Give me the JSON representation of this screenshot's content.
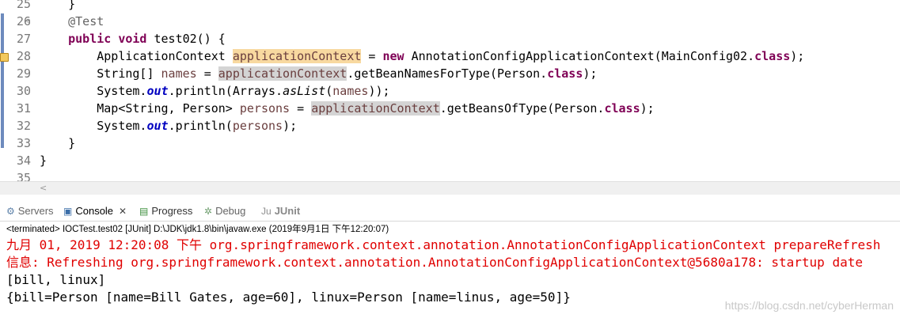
{
  "editor": {
    "lines": [
      {
        "no": "25",
        "fold": "",
        "code": [
          {
            "t": "    }"
          }
        ]
      },
      {
        "no": "26",
        "fold": "⊖",
        "code": [
          {
            "t": "    "
          },
          {
            "t": "@Test",
            "c": "ann"
          }
        ]
      },
      {
        "no": "27",
        "fold": "",
        "code": [
          {
            "t": "    "
          },
          {
            "t": "public",
            "c": "kw"
          },
          {
            "t": " "
          },
          {
            "t": "void",
            "c": "kw"
          },
          {
            "t": " test02() {"
          }
        ]
      },
      {
        "no": "28",
        "fold": "",
        "warn": true,
        "code": [
          {
            "t": "        ApplicationContext "
          },
          {
            "t": "applicationContext",
            "c": "var occ-w"
          },
          {
            "t": " = "
          },
          {
            "t": "new",
            "c": "kw"
          },
          {
            "t": " AnnotationConfigApplicationContext(MainConfig02."
          },
          {
            "t": "class",
            "c": "kw"
          },
          {
            "t": ");"
          }
        ]
      },
      {
        "no": "29",
        "fold": "",
        "code": [
          {
            "t": "        String[] "
          },
          {
            "t": "names",
            "c": "var"
          },
          {
            "t": " = "
          },
          {
            "t": "applicationContext",
            "c": "var occ-r"
          },
          {
            "t": ".getBeanNamesForType(Person."
          },
          {
            "t": "class",
            "c": "kw"
          },
          {
            "t": ");"
          }
        ]
      },
      {
        "no": "30",
        "fold": "",
        "code": [
          {
            "t": "        System."
          },
          {
            "t": "out",
            "c": "fld"
          },
          {
            "t": ".println(Arrays."
          },
          {
            "t": "asList",
            "c": "it"
          },
          {
            "t": "("
          },
          {
            "t": "names",
            "c": "var"
          },
          {
            "t": "));"
          }
        ]
      },
      {
        "no": "31",
        "fold": "",
        "code": [
          {
            "t": "        Map<String, Person> "
          },
          {
            "t": "persons",
            "c": "var"
          },
          {
            "t": " = "
          },
          {
            "t": "applicationContext",
            "c": "var occ-r"
          },
          {
            "t": ".getBeansOfType(Person."
          },
          {
            "t": "class",
            "c": "kw"
          },
          {
            "t": ");"
          }
        ]
      },
      {
        "no": "32",
        "fold": "",
        "code": [
          {
            "t": "        System."
          },
          {
            "t": "out",
            "c": "fld"
          },
          {
            "t": ".println("
          },
          {
            "t": "persons",
            "c": "var"
          },
          {
            "t": ");"
          }
        ]
      },
      {
        "no": "33",
        "fold": "",
        "code": [
          {
            "t": "    }"
          }
        ]
      },
      {
        "no": "34",
        "fold": "",
        "code": [
          {
            "t": "}"
          }
        ]
      },
      {
        "no": "35",
        "fold": "",
        "code": [
          {
            "t": ""
          }
        ]
      }
    ]
  },
  "views": {
    "tabs": [
      {
        "label": "Servers",
        "icon": "servers-icon",
        "glyph": "⚙",
        "color": "#5a7fa8",
        "active": false
      },
      {
        "label": "Console",
        "icon": "console-icon",
        "glyph": "▣",
        "color": "#3b6ea8",
        "active": true,
        "close": "✕"
      },
      {
        "label": "Progress",
        "icon": "progress-icon",
        "glyph": "▤",
        "color": "#3c8f3c",
        "active": false
      },
      {
        "label": "Debug",
        "icon": "debug-icon",
        "glyph": "✲",
        "color": "#6e9e6e",
        "active": false
      },
      {
        "label": "JUnit",
        "icon": "junit-icon",
        "glyph": "Ju",
        "color": "#8e8e8e",
        "active": false
      }
    ]
  },
  "console": {
    "status": "<terminated> IOCTest.test02 [JUnit] D:\\JDK\\jdk1.8\\bin\\javaw.exe (2019年9月1日 下午12:20:07)",
    "lines": [
      {
        "text": "九月 01, 2019 12:20:08 下午 org.springframework.context.annotation.AnnotationConfigApplicationContext prepareRefresh",
        "type": "err"
      },
      {
        "text": "信息: Refreshing org.springframework.context.annotation.AnnotationConfigApplicationContext@5680a178: startup date",
        "type": "err"
      },
      {
        "text": "[bill, linux]",
        "type": "out"
      },
      {
        "text": "{bill=Person [name=Bill Gates, age=60], linux=Person [name=linus, age=50]}",
        "type": "out"
      }
    ],
    "watermark": "https://blog.csdn.net/cyberHerman"
  },
  "colors": {
    "keyword": "#7f0055",
    "error_text": "#e00000",
    "occurrence_write": "#f8d9a0",
    "occurrence_read": "#d4d4d4"
  }
}
